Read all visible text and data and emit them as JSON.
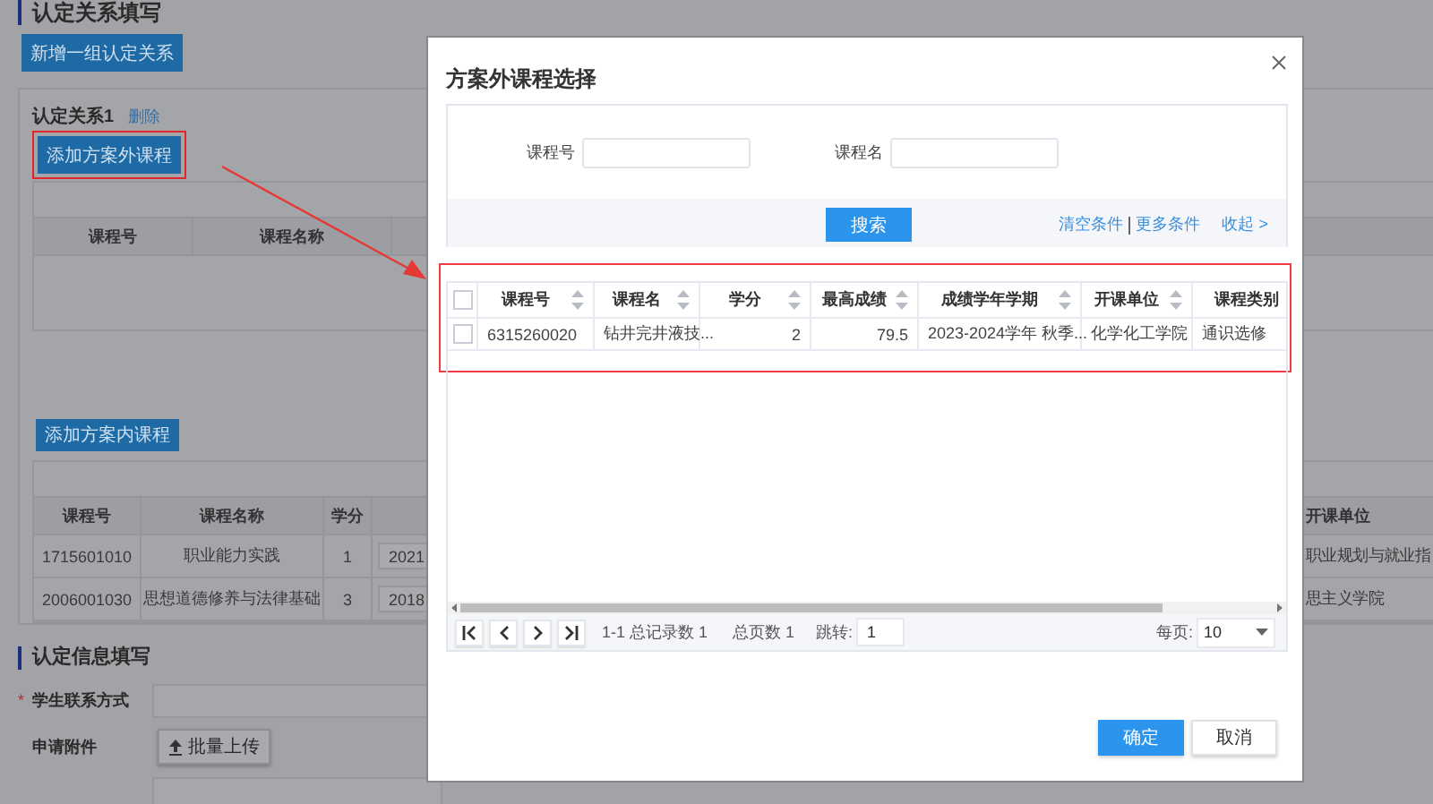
{
  "page": {
    "section_title": "认定关系填写",
    "add_group_button": "新增一组认定关系",
    "relation": {
      "title": "认定关系1",
      "delete_link": "删除",
      "add_external_button": "添加方案外课程",
      "external_highlighted": true,
      "external_table": {
        "columns": [
          "课程号",
          "课程名称"
        ]
      },
      "add_internal_button": "添加方案内课程",
      "internal_table": {
        "columns": [
          "课程号",
          "课程名称",
          "学分",
          "开课单位"
        ],
        "rows": [
          {
            "course_no": "1715601010",
            "course_name": "职业能力实践",
            "credits": "1",
            "term": "2021",
            "department": "职业规划与就业指"
          },
          {
            "course_no": "2006001030",
            "course_name": "思想道德修养与法律基础",
            "credits": "3",
            "term": "2018",
            "department": "思主义学院"
          }
        ]
      }
    },
    "info_section": {
      "title": "认定信息填写",
      "fields": [
        {
          "kind": "text",
          "required_mark": "*",
          "label": "学生联系方式"
        },
        {
          "kind": "upload",
          "label": "申请附件",
          "button": "批量上传"
        }
      ]
    }
  },
  "dialog": {
    "title": "方案外课程选择",
    "search": {
      "fields": [
        {
          "label": "课程号"
        },
        {
          "label": "课程名"
        }
      ],
      "search_button": "搜索",
      "clear_link": "清空条件",
      "more_link": "更多条件",
      "collapse_link": "收起 >"
    },
    "table_highlighted": true,
    "table": {
      "select_all_checked": false,
      "columns": [
        "课程号",
        "课程名",
        "学分",
        "最高成绩",
        "成绩学年学期",
        "开课单位",
        "课程类别"
      ],
      "rows": [
        {
          "checked": false,
          "cells": [
            "6315260020",
            "钻井完井液技...",
            "2",
            "79.5",
            "2023-2024学年 秋季...",
            "化学化工学院",
            "通识选修"
          ]
        }
      ]
    },
    "pager": {
      "summary": "1-1 总记录数 1",
      "pages": "总页数 1",
      "jump_label": "跳转:",
      "jump_value": "1",
      "per_page_label": "每页:",
      "per_page": "10"
    },
    "buttons": [
      {
        "kind": "primary",
        "label": "确定"
      },
      {
        "kind": "default",
        "label": "取消"
      }
    ]
  }
}
